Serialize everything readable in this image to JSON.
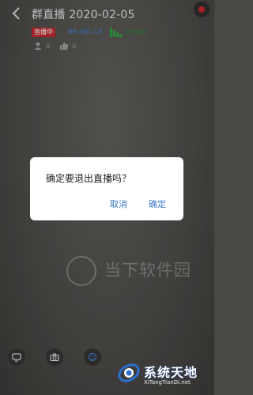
{
  "header": {
    "title": "群直播 2020-02-05",
    "live_badge": "直播中",
    "timer": "00:00:14",
    "signal_text": "信号良好",
    "viewers": "0",
    "likes": "0"
  },
  "dialog": {
    "message": "确定要退出直播吗？",
    "cancel_label": "取消",
    "confirm_label": "确定"
  },
  "toolbar": {
    "icons": [
      "screen-share-icon",
      "camera-icon",
      "beauty-icon"
    ]
  },
  "watermark": {
    "text_top": "当下软件园",
    "title": "系统天地",
    "url": "XiTongTianDi.net"
  },
  "colors": {
    "accent": "#3b78c8",
    "live": "#b8282c",
    "signal": "#2e9a3e"
  }
}
